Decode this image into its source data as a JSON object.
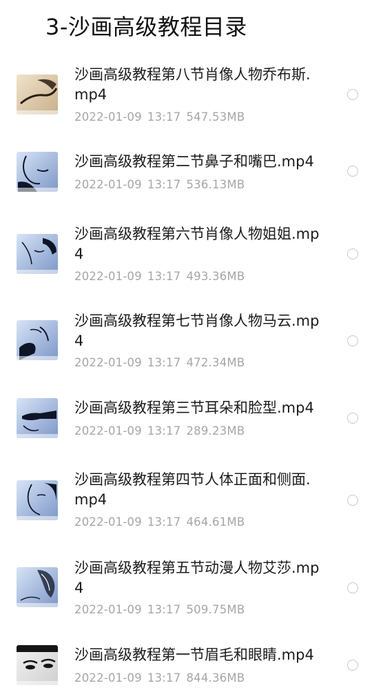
{
  "header": {
    "title": "3-沙画高级教程目录"
  },
  "files": [
    {
      "name": "沙画高级教程第八节肖像人物乔布斯.mp4",
      "date": "2022-01-09",
      "time": "13:17",
      "size": "547.53MB",
      "thumb_style": "warm"
    },
    {
      "name": "沙画高级教程第二节鼻子和嘴巴.mp4",
      "date": "2022-01-09",
      "time": "13:17",
      "size": "536.13MB",
      "thumb_style": "blue"
    },
    {
      "name": "沙画高级教程第六节肖像人物姐姐.mp4",
      "date": "2022-01-09",
      "time": "13:17",
      "size": "493.36MB",
      "thumb_style": "blue"
    },
    {
      "name": "沙画高级教程第七节肖像人物马云.mp4",
      "date": "2022-01-09",
      "time": "13:17",
      "size": "472.34MB",
      "thumb_style": "blue"
    },
    {
      "name": "沙画高级教程第三节耳朵和脸型.mp4",
      "date": "2022-01-09",
      "time": "13:17",
      "size": "289.23MB",
      "thumb_style": "blue"
    },
    {
      "name": "沙画高级教程第四节人体正面和侧面.mp4",
      "date": "2022-01-09",
      "time": "13:17",
      "size": "464.61MB",
      "thumb_style": "blue"
    },
    {
      "name": "沙画高级教程第五节动漫人物艾莎.mp4",
      "date": "2022-01-09",
      "time": "13:17",
      "size": "509.75MB",
      "thumb_style": "blue"
    },
    {
      "name": "沙画高级教程第一节眉毛和眼睛.mp4",
      "date": "2022-01-09",
      "time": "13:17",
      "size": "844.36MB",
      "thumb_style": "pale"
    }
  ],
  "icons": {
    "thumbnail": "video-thumbnail-icon",
    "select": "radio-unchecked-icon"
  },
  "colors": {
    "title": "#1c1c1c",
    "meta": "#a6a6a6",
    "radio_border": "#c9c9c9"
  }
}
